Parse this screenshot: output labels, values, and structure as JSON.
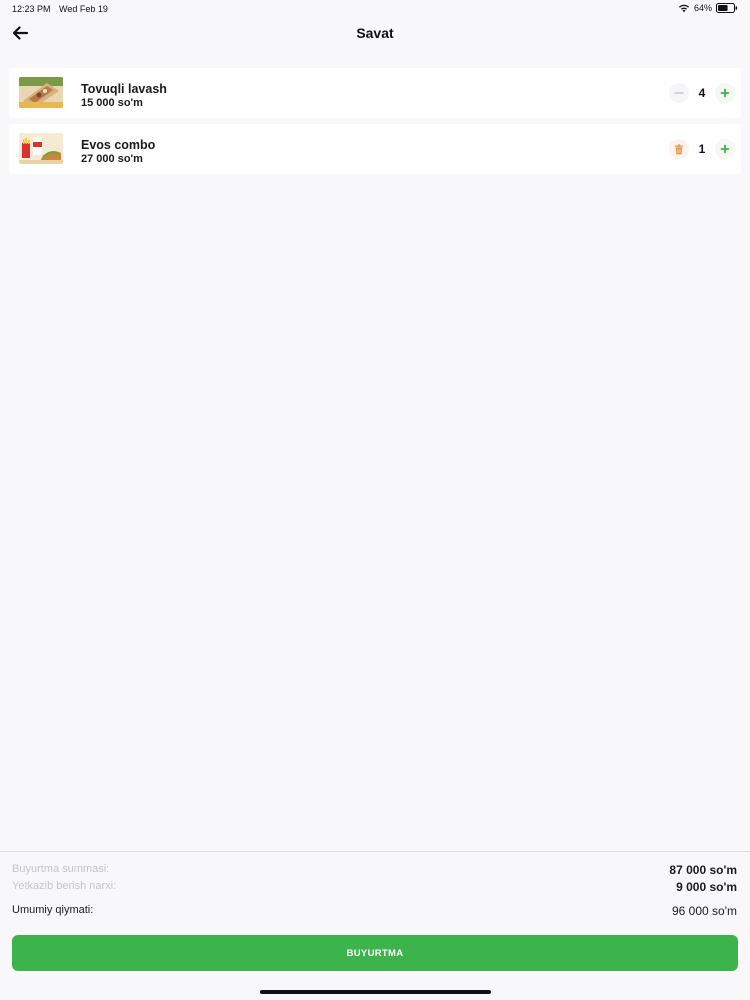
{
  "status_bar": {
    "time": "12:23 PM",
    "date": "Wed Feb 19",
    "battery_percent": "64%",
    "battery_level": 0.64,
    "wifi_icon": "wifi-icon",
    "battery_icon": "battery-icon"
  },
  "header": {
    "title": "Savat",
    "back_icon": "arrow-left-icon"
  },
  "cart": {
    "items": [
      {
        "name": "Tovuqli lavash",
        "price": "15 000 so'm",
        "quantity": "4",
        "decrement_icon": "minus-icon",
        "increment_icon": "plus-icon"
      },
      {
        "name": "Evos combo",
        "price": "27 000 so'm",
        "quantity": "1",
        "decrement_icon": "trash-icon",
        "increment_icon": "plus-icon"
      }
    ]
  },
  "summary": {
    "order_sum_label": "Buyurtma summasi:",
    "order_sum_value": "87 000 so'm",
    "delivery_label": "Yetkazib berish narxi:",
    "delivery_value": "9 000 so'm",
    "total_label": "Umumiy qiymati:",
    "total_value": "96 000 so'm"
  },
  "order_button": {
    "label": "BUYURTMA"
  },
  "colors": {
    "accent_green": "#3cb44b",
    "trash_orange": "#e8944a",
    "background": "#f8f7fa"
  }
}
